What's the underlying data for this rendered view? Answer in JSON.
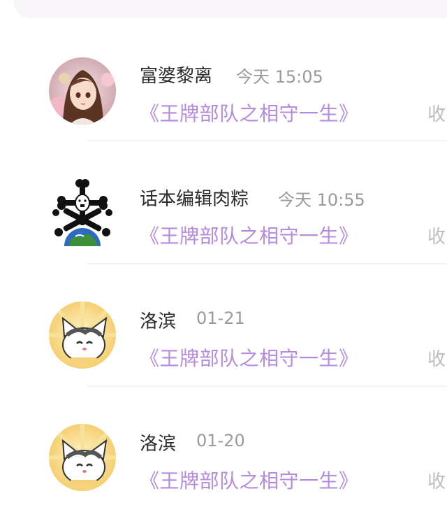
{
  "messages": [
    {
      "name": "富婆黎离",
      "time": "今天 15:05",
      "work": "《王牌部队之相守一生》",
      "action": "收",
      "avatar": "anime-girl-avatar"
    },
    {
      "name": "话本编辑肉粽",
      "time": "今天 10:55",
      "work": "《王牌部队之相守一生》",
      "action": "收",
      "avatar": "bones-globe-avatar"
    },
    {
      "name": "洛滨",
      "time": "01-21",
      "work": "《王牌部队之相守一生》",
      "action": "收",
      "avatar": "cartoon-cat-avatar"
    },
    {
      "name": "洛滨",
      "time": "01-20",
      "work": "《王牌部队之相守一生》",
      "action": "收",
      "avatar": "cartoon-cat-avatar"
    }
  ],
  "colors": {
    "work_title": "#b48be0",
    "name": "#2b2b2b",
    "time": "#9a9a9a",
    "action": "#bdbdbd"
  }
}
